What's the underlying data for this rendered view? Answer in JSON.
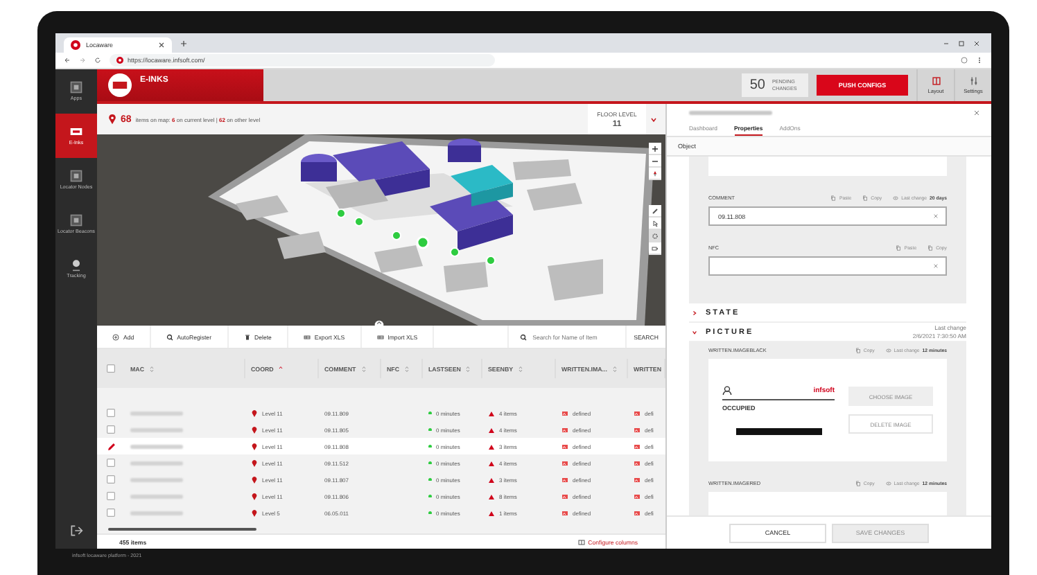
{
  "browser": {
    "tab_title": "Locaware",
    "url": "https://locaware.infsoft.com/"
  },
  "nav": [
    {
      "label": "Apps",
      "selected": false
    },
    {
      "label": "E-Inks",
      "selected": true
    },
    {
      "label": "Locator Nodes",
      "selected": false
    },
    {
      "label": "Locator Beacons",
      "selected": false
    },
    {
      "label": "Tracking",
      "selected": false
    }
  ],
  "header": {
    "title": "E-INKS",
    "pending_count": "50",
    "pending_label": "PENDING CHANGES",
    "push_label": "PUSH CONFIGS",
    "actions": [
      "Layout",
      "Settings"
    ]
  },
  "info": {
    "count": "68",
    "text": "items on map:",
    "current": "6",
    "current_text": "on current level",
    "separator": "|",
    "other": "62",
    "other_text": "on other level",
    "floor_label": "FLOOR LEVEL",
    "floor": "11"
  },
  "toolbar": {
    "buttons": [
      "Add",
      "AutoRegister",
      "Delete",
      "Export XLS",
      "Import XLS"
    ],
    "search_placeholder": "Search for Name of Item",
    "search_button": "SEARCH"
  },
  "table": {
    "all_checked": false,
    "columns": [
      {
        "label": "MAC",
        "sorted": false
      },
      {
        "label": "COORD",
        "sorted": true
      },
      {
        "label": "COMMENT",
        "sorted": false
      },
      {
        "label": "NFC",
        "sorted": false
      },
      {
        "label": "LASTSEEN",
        "sorted": false
      },
      {
        "label": "SEENBY",
        "sorted": false
      },
      {
        "label": "WRITTEN.IMA...",
        "sorted": false
      },
      {
        "label": "WRITTEN"
      }
    ],
    "rows": [
      {
        "checked": false,
        "editing": false,
        "selected": false,
        "coord": "Level 11",
        "comment": "09.11.809",
        "lastseen": "0 minutes",
        "seenby": "4 items",
        "written": "defined",
        "written_2": "defi"
      },
      {
        "checked": false,
        "editing": false,
        "selected": false,
        "coord": "Level 11",
        "comment": "09.11.805",
        "lastseen": "0 minutes",
        "seenby": "4 items",
        "written": "defined",
        "written_2": "defi"
      },
      {
        "editing": true,
        "selected": true,
        "coord": "Level 11",
        "comment": "09.11.808",
        "lastseen": "0 minutes",
        "seenby": "3 items",
        "written": "defined",
        "written_2": "defi"
      },
      {
        "checked": false,
        "editing": false,
        "selected": false,
        "coord": "Level 11",
        "comment": "09.11.512",
        "lastseen": "0 minutes",
        "seenby": "4 items",
        "written": "defined",
        "written_2": "defi"
      },
      {
        "checked": false,
        "editing": false,
        "selected": false,
        "coord": "Level 11",
        "comment": "09.11.807",
        "lastseen": "0 minutes",
        "seenby": "3 items",
        "written": "defined",
        "written_2": "defi"
      },
      {
        "checked": false,
        "editing": false,
        "selected": false,
        "coord": "Level 11",
        "comment": "09.11.806",
        "lastseen": "0 minutes",
        "seenby": "8 items",
        "written": "defined",
        "written_2": "defi"
      },
      {
        "checked": false,
        "editing": false,
        "selected": false,
        "coord": "Level 5",
        "comment": "06.05.011",
        "lastseen": "0 minutes",
        "seenby": "1 items",
        "written": "defined",
        "written_2": "defi"
      }
    ],
    "count": "455 items",
    "configure": "Configure columns"
  },
  "panel": {
    "tabs": [
      {
        "label": "Dashboard",
        "selected": false
      },
      {
        "label": "Properties",
        "selected": true
      },
      {
        "label": "AddOns",
        "selected": false
      }
    ],
    "object_label": "Object",
    "fields": [
      {
        "label": "COMMENT",
        "value": "09.11.808",
        "actions": [
          "Paste",
          "Copy"
        ],
        "last_change": "Last change **20 days**"
      },
      {
        "label": "NFC",
        "actions": [
          "Paste",
          "Copy"
        ]
      }
    ],
    "sections": [
      {
        "label": "STATE",
        "expanded": false
      },
      {
        "label": "PICTURE",
        "expanded": true,
        "last_change": "Last change",
        "last_change_date": "2/6/2021 7:30:50 AM"
      }
    ],
    "images": [
      {
        "label": "WRITTEN.IMAGEBLACK",
        "copy": "Copy",
        "last_change": "Last change **12 minutes**",
        "preview_text": "OCCUPIED",
        "preview_logo": "infsoft",
        "choose": "CHOOSE IMAGE",
        "delete": "DELETE IMAGE"
      },
      {
        "label": "WRITTEN.IMAGERED",
        "copy": "Copy",
        "last_change": "Last change **12 minutes**"
      }
    ],
    "cancel": "CANCEL",
    "save": "SAVE CHANGES",
    "save_disabled": true
  },
  "footer": {
    "text": "infsoft locaware platform - 2021"
  }
}
